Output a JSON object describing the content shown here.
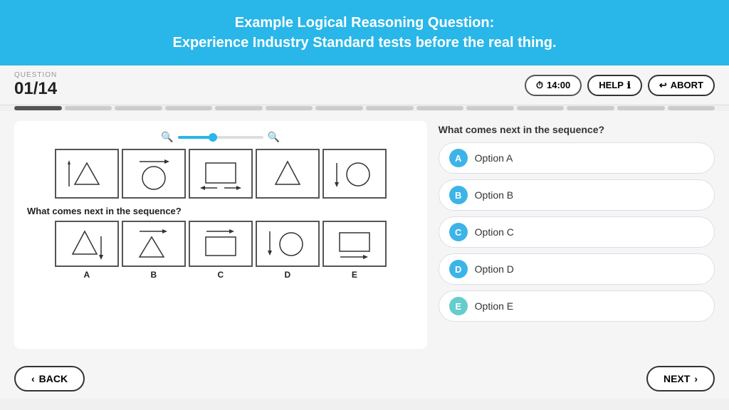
{
  "header": {
    "title_line1": "Example Logical Reasoning Question:",
    "title_line2": "Experience Industry Standard tests before the real thing."
  },
  "question_bar": {
    "label": "QUESTION",
    "number": "01/14",
    "timer": "14:00",
    "help_label": "HELP",
    "abort_label": "ABORT"
  },
  "progress": {
    "total": 14,
    "completed": 1
  },
  "question_panel": {
    "sequence_question": "What comes next in the sequence?",
    "answer_question": "What comes next in the sequence?"
  },
  "options": {
    "question": "What comes next in the sequence?",
    "items": [
      {
        "letter": "A",
        "label": "Option A"
      },
      {
        "letter": "B",
        "label": "Option B"
      },
      {
        "letter": "C",
        "label": "Option C"
      },
      {
        "letter": "D",
        "label": "Option D"
      },
      {
        "letter": "E",
        "label": "Option E"
      }
    ]
  },
  "footer": {
    "back_label": "BACK",
    "next_label": "NEXT"
  }
}
